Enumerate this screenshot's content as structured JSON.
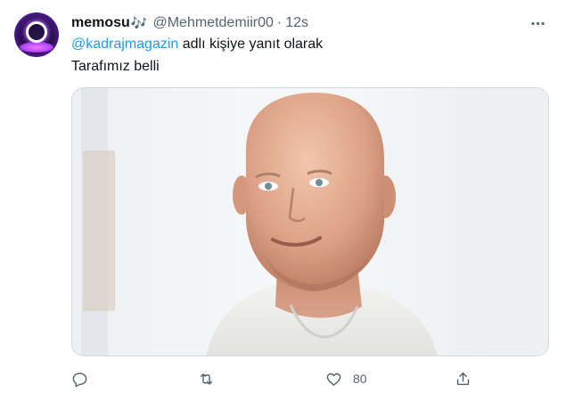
{
  "tweet": {
    "display_name": "memosu",
    "name_emoji": "🎶",
    "handle": "@Mehmetdemiir00",
    "separator": "·",
    "time": "12s",
    "reply_mention": "@kadrajmagazin",
    "reply_suffix": " adlı kişiye yanıt olarak",
    "text": "Tarafımız belli",
    "media_alt": "photo of a bald smiling man in a white t-shirt"
  },
  "actions": {
    "reply": {
      "icon": "reply-icon",
      "count": ""
    },
    "retweet": {
      "icon": "retweet-icon",
      "count": ""
    },
    "like": {
      "icon": "heart-icon",
      "count": "80"
    },
    "share": {
      "icon": "share-icon",
      "count": ""
    }
  },
  "colors": {
    "text_primary": "#0f1419",
    "text_secondary": "#536471",
    "link": "#1d9bf0",
    "border": "#cfd9de"
  }
}
